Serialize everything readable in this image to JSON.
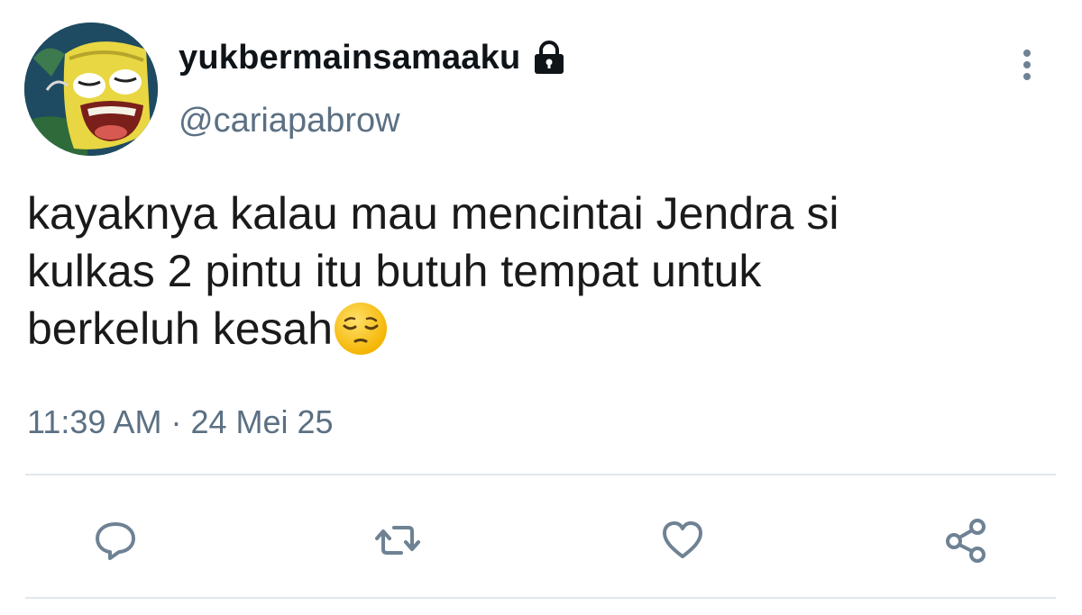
{
  "tweet": {
    "display_name": "yukbermainsamaaku",
    "handle": "@cariapabrow",
    "text_line1": "kayaknya kalau mau mencintai Jendra si",
    "text_line2": "kulkas 2 pintu itu butuh tempat untuk",
    "text_line3": "berkeluh kesah",
    "emoji": "pensive-face",
    "time": "11:39 AM",
    "separator": "·",
    "date": "24 Mei 25",
    "protected_icon": "lock-icon"
  },
  "actions": [
    {
      "icon": "reply-icon"
    },
    {
      "icon": "retweet-icon"
    },
    {
      "icon": "like-icon"
    },
    {
      "icon": "share-icon"
    }
  ],
  "colors": {
    "text": "#0f1419",
    "secondary": "#5b7083",
    "icon": "#6e8294",
    "divider": "#e1e8ed"
  }
}
